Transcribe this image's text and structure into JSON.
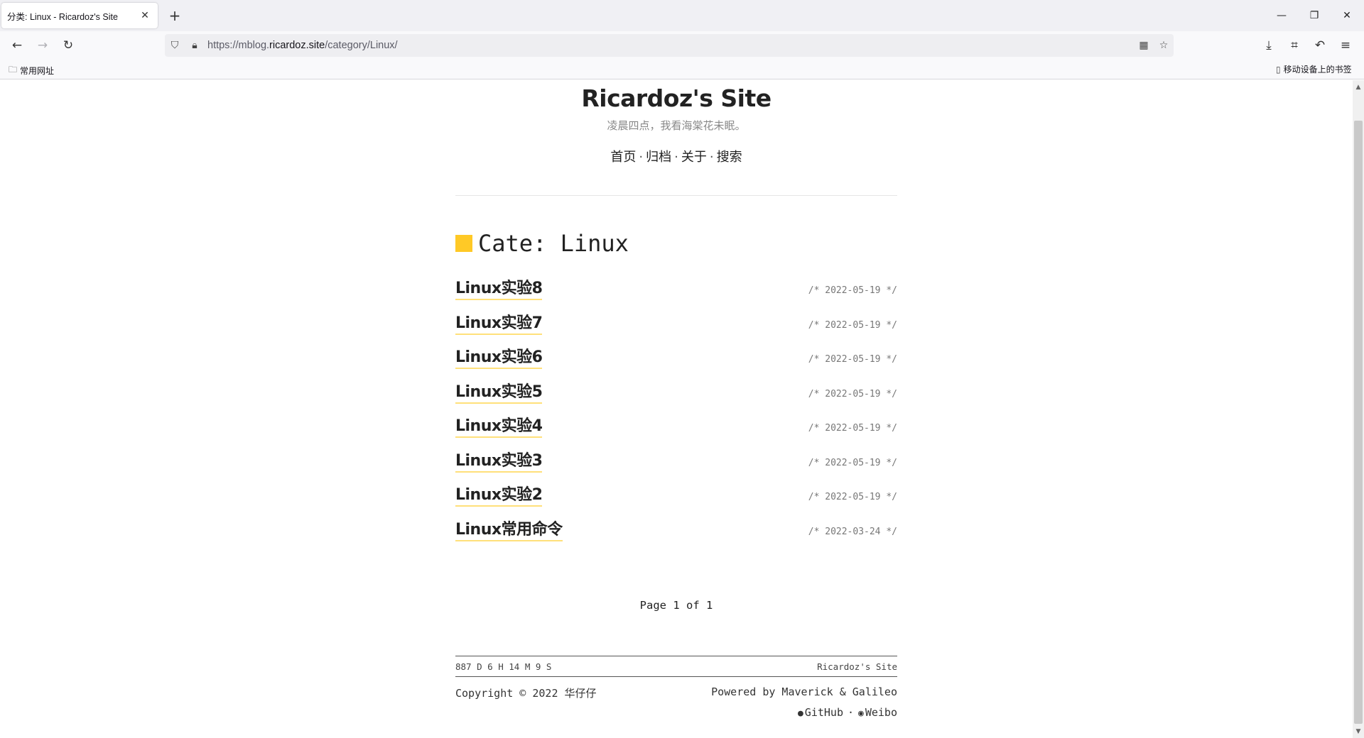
{
  "browser": {
    "tab_title": "分类: Linux - Ricardoz's Site",
    "url_prefix": "https://mblog.",
    "url_host": "ricardoz.site",
    "url_path": "/category/Linux/",
    "bookmark_left": "常用网址",
    "bookmark_right": "移动设备上的书签"
  },
  "site": {
    "title": "Ricardoz's Site",
    "subtitle": "凌晨四点，我看海棠花未眠。",
    "nav": [
      "首页",
      "归档",
      "关于",
      "搜索"
    ],
    "nav_sep": "·"
  },
  "category": {
    "heading": "Cate: Linux",
    "accent_color": "#ffc926"
  },
  "posts": [
    {
      "title": "Linux实验8",
      "date": "/* 2022-05-19 */"
    },
    {
      "title": "Linux实验7",
      "date": "/* 2022-05-19 */"
    },
    {
      "title": "Linux实验6",
      "date": "/* 2022-05-19 */"
    },
    {
      "title": "Linux实验5",
      "date": "/* 2022-05-19 */"
    },
    {
      "title": "Linux实验4",
      "date": "/* 2022-05-19 */"
    },
    {
      "title": "Linux实验3",
      "date": "/* 2022-05-19 */"
    },
    {
      "title": "Linux实验2",
      "date": "/* 2022-05-19 */"
    },
    {
      "title": "Linux常用命令",
      "date": "/* 2022-03-24 */"
    }
  ],
  "pager": "Page 1 of 1",
  "footer": {
    "uptime": "887 D 6 H 14 M 9 S",
    "site_name": "Ricardoz's Site",
    "copyright": "Copyright © 2022 华仔仔",
    "powered": "Powered by Maverick & Galileo",
    "links": [
      "GitHub",
      "Weibo"
    ],
    "link_sep": "·"
  },
  "icons": {
    "back": "back-arrow-icon",
    "forward": "forward-arrow-icon",
    "reload": "reload-icon",
    "shield": "shield-icon",
    "lock": "lock-icon",
    "qr": "qr-code-icon",
    "star": "bookmark-star-icon",
    "download": "download-icon",
    "crop": "screenshot-icon",
    "undo": "undo-icon",
    "menu": "hamburger-menu-icon"
  }
}
